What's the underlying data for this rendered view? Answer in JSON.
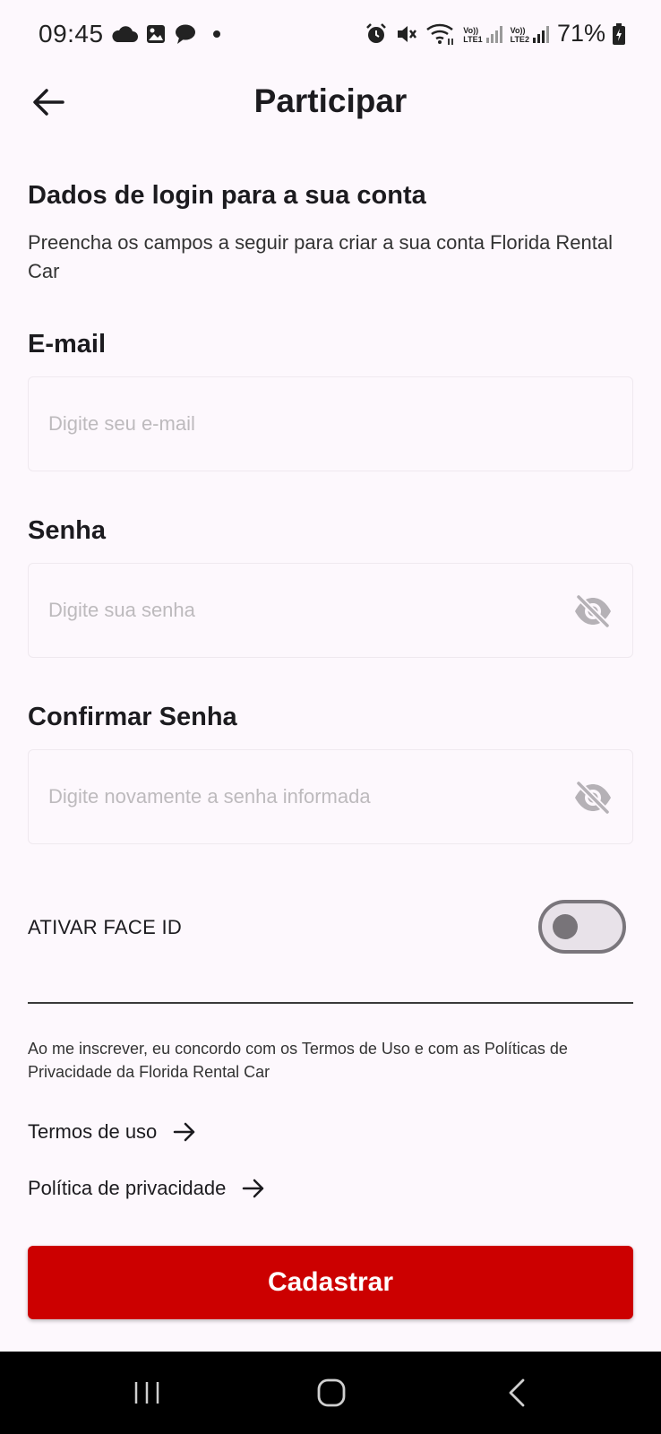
{
  "status_bar": {
    "time": "09:45",
    "battery": "71%",
    "lte1": "LTE1",
    "lte2": "LTE2",
    "volte": "Vo))",
    "left_icons": [
      "cloud-icon",
      "image-icon",
      "chat-bubble-icon",
      "dot-icon"
    ],
    "right_icons": [
      "alarm-icon",
      "mute-icon",
      "wifi-icon",
      "signal-lte1-icon",
      "signal-lte2-icon",
      "battery-charging-icon"
    ]
  },
  "header": {
    "title": "Participar",
    "back_icon": "arrow-left-icon"
  },
  "section": {
    "title": "Dados de login para a sua conta",
    "description": "Preencha os campos a seguir para criar a sua conta Florida Rental Car"
  },
  "form": {
    "email": {
      "label": "E-mail",
      "placeholder": "Digite seu e-mail",
      "value": ""
    },
    "password": {
      "label": "Senha",
      "placeholder": "Digite sua senha",
      "value": "",
      "icon": "eye-off-icon"
    },
    "confirm_password": {
      "label": "Confirmar Senha",
      "placeholder": "Digite novamente a senha informada",
      "value": "",
      "icon": "eye-off-icon"
    },
    "face_id": {
      "label": "ATIVAR FACE ID",
      "enabled": false
    }
  },
  "terms": {
    "text": "Ao me inscrever, eu concordo com os Termos de Uso e com as Políticas de Privacidade da Florida Rental Car",
    "links": [
      {
        "label": "Termos de uso",
        "icon": "arrow-right-icon"
      },
      {
        "label": "Política de privacidade",
        "icon": "arrow-right-icon"
      }
    ]
  },
  "actions": {
    "submit_label": "Cadastrar"
  },
  "nav_bar": {
    "buttons": [
      "recents-icon",
      "home-icon",
      "back-icon"
    ]
  },
  "colors": {
    "primary": "#CC0000",
    "background": "#FDF8FD",
    "text": "#1C1B1F",
    "placeholder": "#BDBABD",
    "switch_track": "#E8E2E9"
  }
}
